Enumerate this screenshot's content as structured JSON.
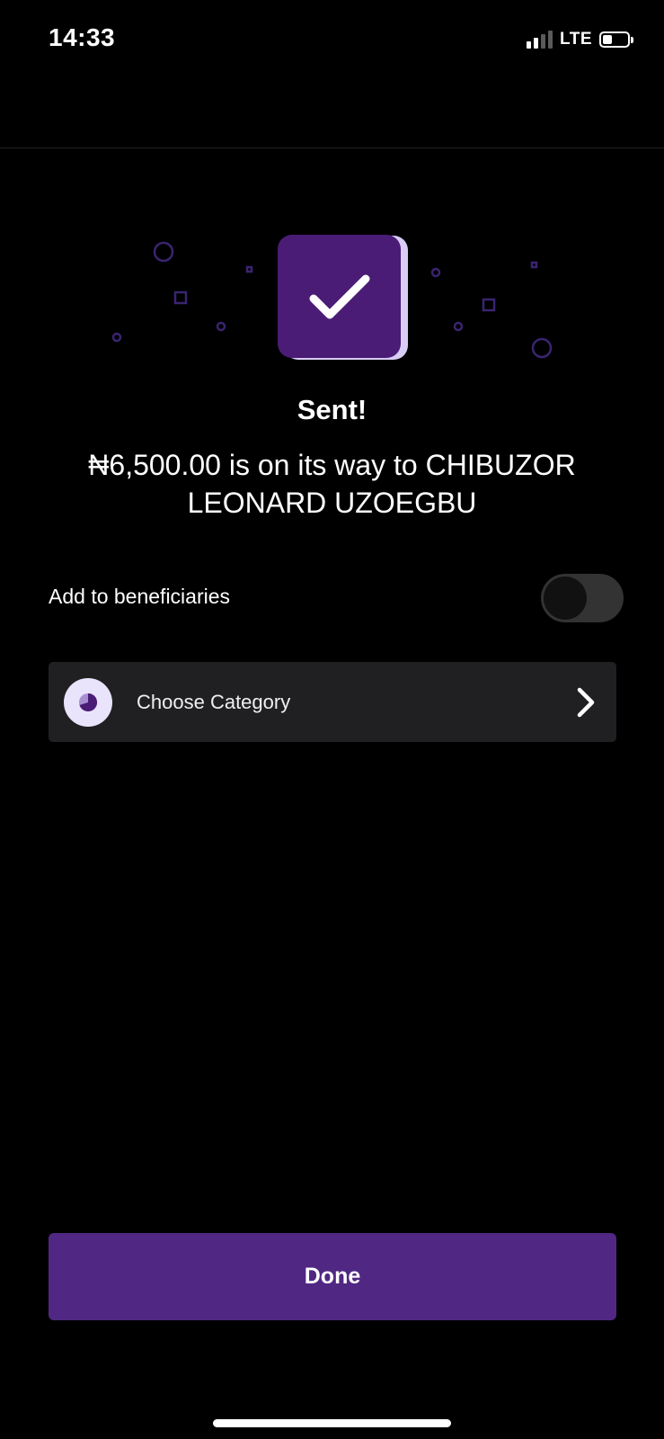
{
  "status_bar": {
    "time": "14:33",
    "network": "LTE",
    "signal_bars_active": 2,
    "signal_bars_total": 4,
    "battery_level": 0.4
  },
  "hero": {
    "icon": "checkmark-icon",
    "accent_color": "#4a1c76",
    "shadow_color": "#d9ccf5"
  },
  "headline": "Sent!",
  "message": "₦6,500.00 is on its way to CHIBUZOR LEONARD UZOEGBU",
  "beneficiary": {
    "label": "Add to beneficiaries",
    "toggle_on": false
  },
  "category": {
    "label": "Choose Category",
    "icon": "pie-chart-icon",
    "chevron_icon": "chevron-right-icon"
  },
  "done_button": {
    "label": "Done",
    "color": "#502883"
  }
}
